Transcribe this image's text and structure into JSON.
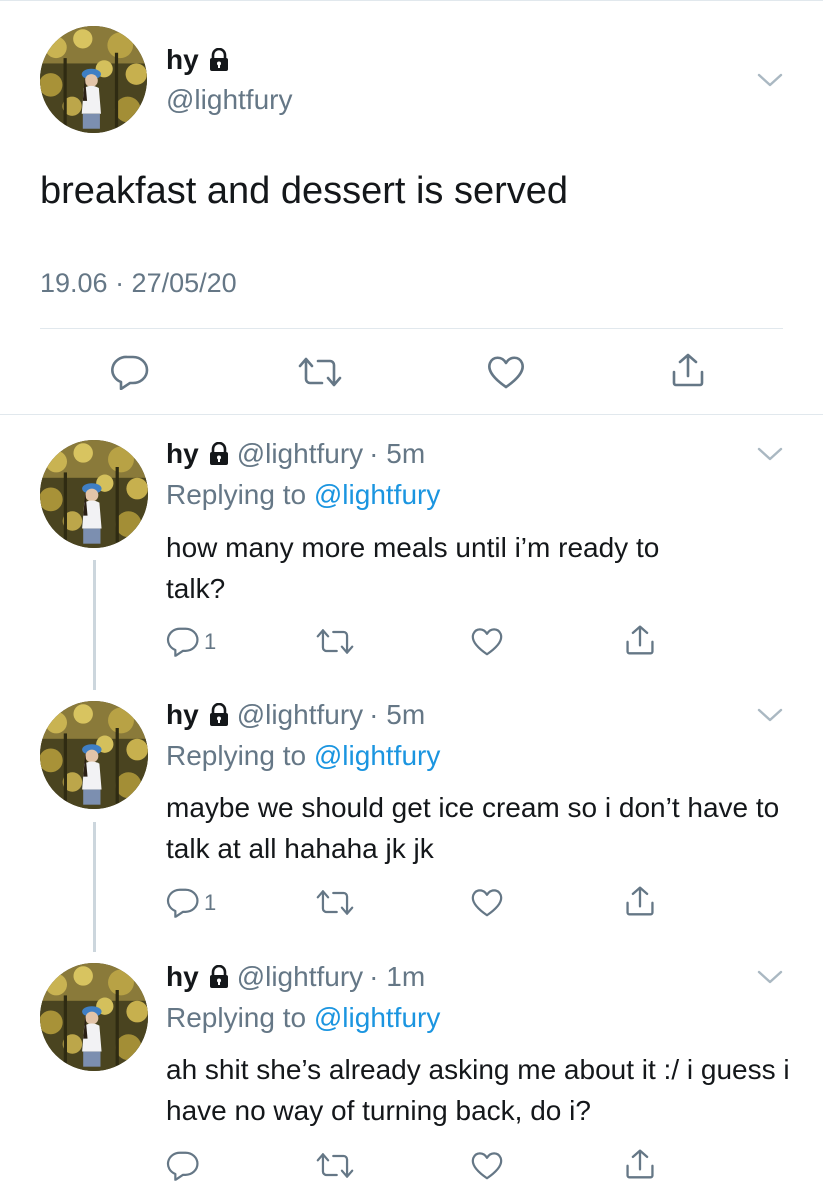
{
  "main_tweet": {
    "name": "hy",
    "handle": "@lightfury",
    "text": "breakfast and dessert is served",
    "timestamp": "19.06 · 27/05/20",
    "icons": [
      "lock-icon",
      "chevron-down-icon",
      "reply-icon",
      "retweet-icon",
      "like-icon",
      "share-icon"
    ]
  },
  "replies": [
    {
      "name": "hy",
      "handle": "@lightfury",
      "time": "· 5m",
      "replying_prefix": "Replying to ",
      "replying_to": "@lightfury",
      "text": "how many more meals until i’m ready to talk?",
      "reply_count": "1"
    },
    {
      "name": "hy",
      "handle": "@lightfury",
      "time": "· 5m",
      "replying_prefix": "Replying to ",
      "replying_to": "@lightfury",
      "text": "maybe we should get ice cream so i don’t have to talk at all hahaha jk jk",
      "reply_count": "1"
    },
    {
      "name": "hy",
      "handle": "@lightfury",
      "time": "· 1m",
      "replying_prefix": "Replying to ",
      "replying_to": "@lightfury",
      "text": "ah shit she’s already asking me about it :/ i guess i have no way of turning back, do i?",
      "reply_count": ""
    }
  ],
  "colors": {
    "text": "#14171a",
    "secondary": "#657786",
    "link": "#1b95e0",
    "divider": "#e1e8ed",
    "thread_line": "#ccd6dd"
  }
}
